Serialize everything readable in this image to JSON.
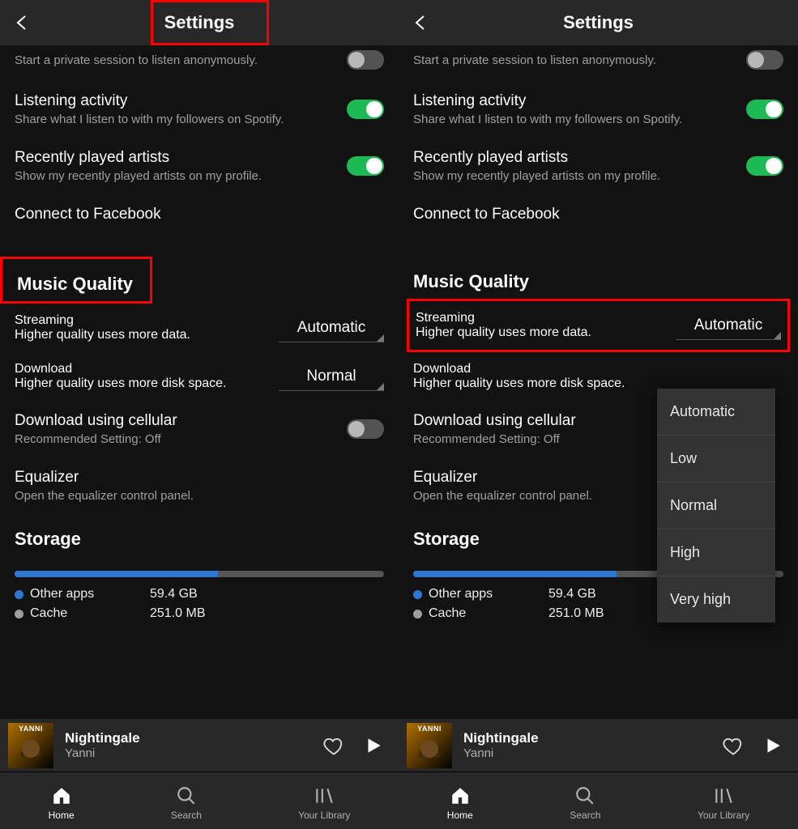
{
  "header": {
    "title": "Settings"
  },
  "settings": {
    "private_session": {
      "sub": "Start a private session to listen anonymously."
    },
    "listening": {
      "title": "Listening activity",
      "sub": "Share what I listen to with my followers on Spotify."
    },
    "recent": {
      "title": "Recently played artists",
      "sub": "Show my recently played artists on my profile."
    },
    "facebook": {
      "title": "Connect to Facebook"
    }
  },
  "music_quality": {
    "head": "Music Quality",
    "streaming": {
      "title": "Streaming",
      "sub": "Higher quality uses more data.",
      "value": "Automatic"
    },
    "download": {
      "title": "Download",
      "sub": "Higher quality uses more disk space.",
      "value": "Normal"
    },
    "cellular": {
      "title": "Download using cellular",
      "sub": "Recommended Setting: Off"
    },
    "equalizer": {
      "title": "Equalizer",
      "sub": "Open the equalizer control panel."
    }
  },
  "storage": {
    "head": "Storage",
    "other": {
      "label": "Other apps",
      "value": "59.4 GB"
    },
    "cache": {
      "label": "Cache",
      "value": "251.0 MB"
    }
  },
  "now_playing": {
    "title": "Nightingale",
    "artist": "Yanni"
  },
  "tabs": {
    "home": "Home",
    "search": "Search",
    "library": "Your Library"
  },
  "dropdown": {
    "options": [
      "Automatic",
      "Low",
      "Normal",
      "High",
      "Very high"
    ]
  }
}
